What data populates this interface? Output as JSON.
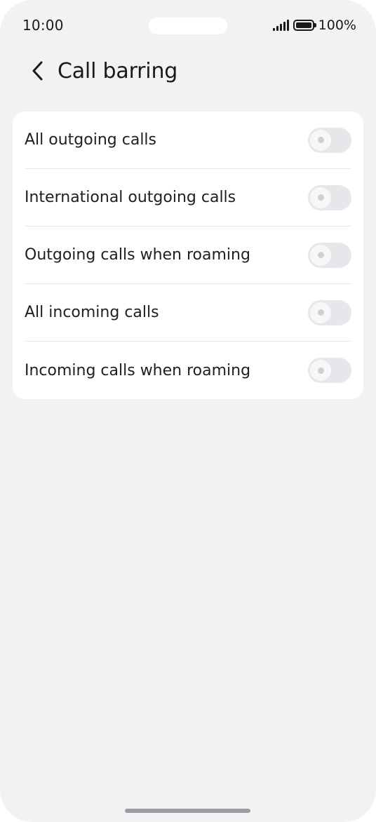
{
  "status_bar": {
    "time": "10:00",
    "battery": "100%"
  },
  "header": {
    "back_icon": "chevron-left-icon",
    "title": "Call barring"
  },
  "settings": [
    {
      "label": "All outgoing calls",
      "enabled": false
    },
    {
      "label": "International outgoing calls",
      "enabled": false
    },
    {
      "label": "Outgoing calls when roaming",
      "enabled": false
    },
    {
      "label": "All incoming calls",
      "enabled": false
    },
    {
      "label": "Incoming calls when roaming",
      "enabled": false
    }
  ],
  "colors": {
    "background": "#f1f2f4",
    "card": "#ffffff",
    "toggle_off": "#e6e7ea",
    "text": "#1f1f1f"
  }
}
